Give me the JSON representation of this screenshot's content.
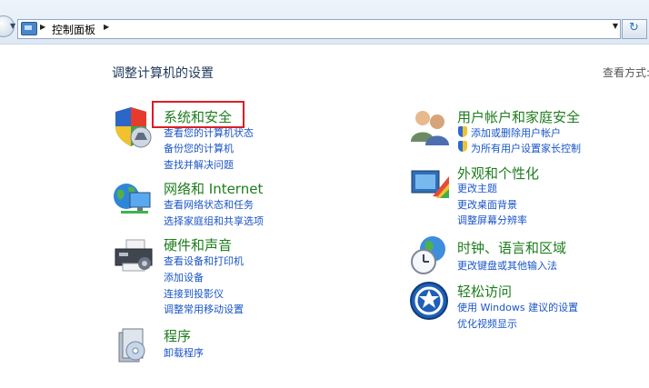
{
  "address": {
    "breadcrumb": "控制面板"
  },
  "page": {
    "title": "调整计算机的设置",
    "view_by": "查看方式:"
  },
  "categories": [
    {
      "title": "系统和安全",
      "links": [
        "查看您的计算机状态",
        "备份您的计算机",
        "查找并解决问题"
      ],
      "icon": "shield-pc-icon"
    },
    {
      "title": "网络和 Internet",
      "links": [
        "查看网络状态和任务",
        "选择家庭组和共享选项"
      ],
      "icon": "network-icon"
    },
    {
      "title": "硬件和声音",
      "links": [
        "查看设备和打印机",
        "添加设备",
        "连接到投影仪",
        "调整常用移动设置"
      ],
      "icon": "printer-icon"
    },
    {
      "title": "程序",
      "links": [
        "卸载程序"
      ],
      "icon": "programs-icon"
    },
    {
      "title": "用户帐户和家庭安全",
      "links": [
        "添加或删除用户帐户",
        "为所有用户设置家长控制"
      ],
      "icon": "users-icon"
    },
    {
      "title": "外观和个性化",
      "links": [
        "更改主题",
        "更改桌面背景",
        "调整屏幕分辨率"
      ],
      "icon": "appearance-icon"
    },
    {
      "title": "时钟、语言和区域",
      "links": [
        "更改键盘或其他输入法"
      ],
      "icon": "clock-globe-icon"
    },
    {
      "title": "轻松访问",
      "links": [
        "使用 Windows 建议的设置",
        "优化视频显示"
      ],
      "icon": "ease-of-access-icon"
    }
  ],
  "colors": {
    "category_title": "#1e7d1e",
    "link": "#1a55c7",
    "highlight_box": "#e01b24"
  }
}
